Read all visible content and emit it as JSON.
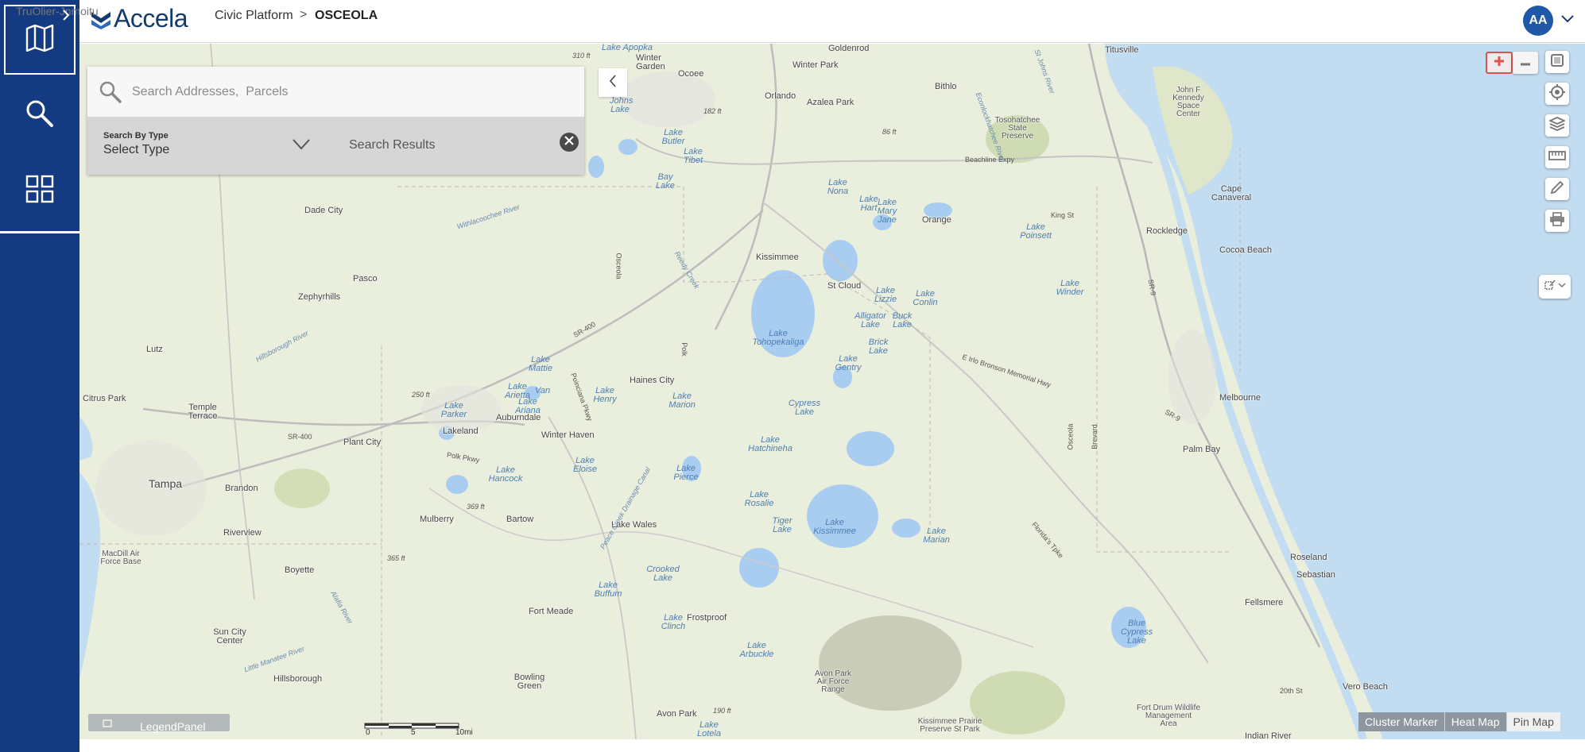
{
  "header": {
    "brand": "Accela",
    "breadcrumb_app": "Civic Platform",
    "breadcrumb_sep": ">",
    "breadcrumb_current": "OSCEOLA",
    "user_initials": "AA"
  },
  "overlay_text": "TruOlier-Jnmoitu",
  "search": {
    "placeholder": "Search Addresses,  Parcels",
    "type_label": "Search By Type",
    "type_value": "Select Type",
    "results_label": "Search Results"
  },
  "map": {
    "places": [
      {
        "t": "Goldenrod"
      },
      {
        "t": "Titusville"
      },
      {
        "t": "Winter Garden"
      },
      {
        "t": "Ocoee"
      },
      {
        "t": "Winter Park"
      },
      {
        "t": "Orlando"
      },
      {
        "t": "Azalea Park"
      },
      {
        "t": "Bithlo"
      },
      {
        "t": "John F Kennedy Space Center"
      },
      {
        "t": "Tosohatchee State Preserve"
      },
      {
        "t": "Dade City"
      },
      {
        "t": "Orange"
      },
      {
        "t": "Cape Canaveral"
      },
      {
        "t": "Rockledge"
      },
      {
        "t": "Cocoa Beach"
      },
      {
        "t": "Kissimmee"
      },
      {
        "t": "St Cloud"
      },
      {
        "t": "Pasco"
      },
      {
        "t": "Zephyrhills"
      },
      {
        "t": "Lutz"
      },
      {
        "t": "Haines City"
      },
      {
        "t": "Citrus Park"
      },
      {
        "t": "Temple Terrace"
      },
      {
        "t": "Auburndale"
      },
      {
        "t": "Lakeland"
      },
      {
        "t": "Plant City"
      },
      {
        "t": "Winter Haven"
      },
      {
        "t": "Melbourne"
      },
      {
        "t": "Palm Bay"
      },
      {
        "t": "Tampa"
      },
      {
        "t": "Brandon"
      },
      {
        "t": "Mulberry"
      },
      {
        "t": "Bartow"
      },
      {
        "t": "Lake Wales"
      },
      {
        "t": "Riverview"
      },
      {
        "t": "MacDill Air Force Base"
      },
      {
        "t": "Boyette"
      },
      {
        "t": "Roseland"
      },
      {
        "t": "Sebastian"
      },
      {
        "t": "Fellsmere"
      },
      {
        "t": "Fort Meade"
      },
      {
        "t": "Frostproof"
      },
      {
        "t": "Sun City Center"
      },
      {
        "t": "Hillsborough"
      },
      {
        "t": "Bowling Green"
      },
      {
        "t": "Avon Park Air Force Range"
      },
      {
        "t": "Vero Beach"
      },
      {
        "t": "Avon Park"
      },
      {
        "t": "Fort Drum Wildlife Management Area"
      },
      {
        "t": "Kissimmee Prairie Preserve St Park"
      },
      {
        "t": "Indian River"
      }
    ],
    "lakes": [
      {
        "t": "Lake Apopka"
      },
      {
        "t": "Johns Lake"
      },
      {
        "t": "Lake Butler"
      },
      {
        "t": "Lake Tibet"
      },
      {
        "t": "Bay Lake"
      },
      {
        "t": "Lake Nona"
      },
      {
        "t": "Lake Hart"
      },
      {
        "t": "Lake Mary Jane"
      },
      {
        "t": "Lake Poinsett"
      },
      {
        "t": "Lake Winder"
      },
      {
        "t": "Lake Lizzie"
      },
      {
        "t": "Lake Conlin"
      },
      {
        "t": "Alligator Lake"
      },
      {
        "t": "Buck Lake"
      },
      {
        "t": "Lake Tohopekaliga"
      },
      {
        "t": "Brick Lake"
      },
      {
        "t": "Lake Gentry"
      },
      {
        "t": "Lake Mattie"
      },
      {
        "t": "Lake Arietta"
      },
      {
        "t": "Van"
      },
      {
        "t": "Lake Ariana"
      },
      {
        "t": "Lake Henry"
      },
      {
        "t": "Lake Marion"
      },
      {
        "t": "Cypress Lake"
      },
      {
        "t": "Lake Parker"
      },
      {
        "t": "Lake Hatchineha"
      },
      {
        "t": "Lake Hancock"
      },
      {
        "t": "Lake Eloise"
      },
      {
        "t": "Lake Pierce"
      },
      {
        "t": "Lake Rosalie"
      },
      {
        "t": "Tiger Lake"
      },
      {
        "t": "Lake Kissimmee"
      },
      {
        "t": "Lake Marian"
      },
      {
        "t": "Crooked Lake"
      },
      {
        "t": "Lake Buffum"
      },
      {
        "t": "Lake Clinch"
      },
      {
        "t": "Lake Arbuckle"
      },
      {
        "t": "Blue Cypress Lake"
      },
      {
        "t": "Lake Lotela"
      }
    ],
    "roads": [
      {
        "t": "SR-400"
      },
      {
        "t": "SR-400"
      },
      {
        "t": "Beachline Expy"
      },
      {
        "t": "King St"
      },
      {
        "t": "E Irlo Bronson Memorial Hwy"
      },
      {
        "t": "Osceola"
      },
      {
        "t": "Polk"
      },
      {
        "t": "Osceola"
      },
      {
        "t": "Brevard"
      },
      {
        "t": "SR-9"
      },
      {
        "t": "SR-9"
      },
      {
        "t": "Withlacoochee River"
      },
      {
        "t": "Hillsborough River"
      },
      {
        "t": "Reedy Creek"
      },
      {
        "t": "Little Manatee River"
      },
      {
        "t": "Alafia River"
      },
      {
        "t": "Peace Creek Drainage Canal"
      },
      {
        "t": "Poinciana Pkwy"
      },
      {
        "t": "Florida's Tpke"
      },
      {
        "t": "Polk Pkwy"
      },
      {
        "t": "Econlockhatchee River"
      },
      {
        "t": "St Johns River"
      },
      {
        "t": "20th St"
      },
      {
        "t": "310 ft"
      },
      {
        "t": "182 ft"
      },
      {
        "t": "86 ft"
      },
      {
        "t": "250 ft"
      },
      {
        "t": "369 ft"
      },
      {
        "t": "365 ft"
      },
      {
        "t": "190 ft"
      }
    ]
  },
  "legend_panel": "LegendPanel",
  "scale": {
    "l0": "0",
    "l1": "5",
    "l2": "10mi"
  },
  "modes": [
    {
      "label": "Cluster Marker",
      "active": false
    },
    {
      "label": "Heat Map",
      "active": false
    },
    {
      "label": "Pin Map",
      "active": true
    }
  ]
}
